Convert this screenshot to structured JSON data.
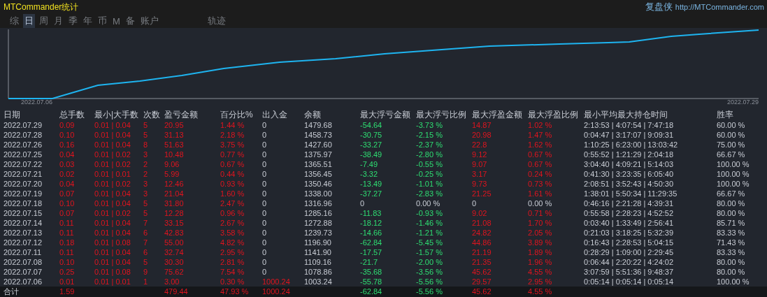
{
  "app_title": "MTCommander统计",
  "brand": {
    "name": "复盘侠",
    "url": "http://MTCommander.com"
  },
  "tabs": [
    {
      "label": "综",
      "selected": false
    },
    {
      "label": "日",
      "selected": true
    },
    {
      "label": "周",
      "selected": false
    },
    {
      "label": "月",
      "selected": false
    },
    {
      "label": "季",
      "selected": false
    },
    {
      "label": "年",
      "selected": false
    },
    {
      "label": "币",
      "selected": false
    },
    {
      "label": "M",
      "selected": false
    },
    {
      "label": "备",
      "selected": false
    },
    {
      "label": "账户",
      "selected": false
    },
    {
      "label": "轨迹",
      "selected": false
    }
  ],
  "chart": {
    "start_label": "2022.07.06",
    "end_label": "2022.07.29"
  },
  "table": {
    "columns": [
      "日期",
      "总手数",
      "最小|大手数",
      "次数",
      "盈亏金额",
      "百分比%",
      "出入金",
      "余额",
      "最大浮亏金额",
      "最大浮亏比例",
      "最大浮盈金额",
      "最大浮盈比例",
      "最小平均最大持仓时间",
      "胜率"
    ],
    "rows": [
      {
        "date": "2022.07.29",
        "lots": "0.09",
        "minmax": "0.01 | 0.04",
        "count": "5",
        "pnl": "20.95",
        "pct": "1.44 %",
        "flow": "0",
        "balance": "1479.68",
        "max_loss": "-54.64",
        "max_loss_pct": "-3.73 %",
        "max_gain": "14.87",
        "max_gain_pct": "1.02 %",
        "hold": "2:13:53 | 4:07:54 | 7:47:18",
        "win": "60.00 %",
        "deposit": false,
        "float_flat": false
      },
      {
        "date": "2022.07.28",
        "lots": "0.10",
        "minmax": "0.01 | 0.04",
        "count": "5",
        "pnl": "31.13",
        "pct": "2.18 %",
        "flow": "0",
        "balance": "1458.73",
        "max_loss": "-30.75",
        "max_loss_pct": "-2.15 %",
        "max_gain": "20.98",
        "max_gain_pct": "1.47 %",
        "hold": "0:04:47 | 3:17:07 | 9:09:31",
        "win": "60.00 %",
        "deposit": false,
        "float_flat": false
      },
      {
        "date": "2022.07.26",
        "lots": "0.16",
        "minmax": "0.01 | 0.04",
        "count": "8",
        "pnl": "51.63",
        "pct": "3.75 %",
        "flow": "0",
        "balance": "1427.60",
        "max_loss": "-33.27",
        "max_loss_pct": "-2.37 %",
        "max_gain": "22.8",
        "max_gain_pct": "1.62 %",
        "hold": "1:10:25 | 6:23:00 | 13:03:42",
        "win": "75.00 %",
        "deposit": false,
        "float_flat": false
      },
      {
        "date": "2022.07.25",
        "lots": "0.04",
        "minmax": "0.01 | 0.02",
        "count": "3",
        "pnl": "10.48",
        "pct": "0.77 %",
        "flow": "0",
        "balance": "1375.97",
        "max_loss": "-38.49",
        "max_loss_pct": "-2.80 %",
        "max_gain": "9.12",
        "max_gain_pct": "0.67 %",
        "hold": "0:55:52 | 1:21:29 | 2:04:18",
        "win": "66.67 %",
        "deposit": false,
        "float_flat": false
      },
      {
        "date": "2022.07.22",
        "lots": "0.03",
        "minmax": "0.01 | 0.02",
        "count": "2",
        "pnl": "9.06",
        "pct": "0.67 %",
        "flow": "0",
        "balance": "1365.51",
        "max_loss": "-7.49",
        "max_loss_pct": "-0.55 %",
        "max_gain": "9.07",
        "max_gain_pct": "0.67 %",
        "hold": "3:04:40 | 4:09:21 | 5:14:03",
        "win": "100.00 %",
        "deposit": false,
        "float_flat": false
      },
      {
        "date": "2022.07.21",
        "lots": "0.02",
        "minmax": "0.01 | 0.01",
        "count": "2",
        "pnl": "5.99",
        "pct": "0.44 %",
        "flow": "0",
        "balance": "1356.45",
        "max_loss": "-3.32",
        "max_loss_pct": "-0.25 %",
        "max_gain": "3.17",
        "max_gain_pct": "0.24 %",
        "hold": "0:41:30 | 3:23:35 | 6:05:40",
        "win": "100.00 %",
        "deposit": false,
        "float_flat": false
      },
      {
        "date": "2022.07.20",
        "lots": "0.04",
        "minmax": "0.01 | 0.02",
        "count": "3",
        "pnl": "12.46",
        "pct": "0.93 %",
        "flow": "0",
        "balance": "1350.46",
        "max_loss": "-13.49",
        "max_loss_pct": "-1.01 %",
        "max_gain": "9.73",
        "max_gain_pct": "0.73 %",
        "hold": "2:08:51 | 3:52:43 | 4:50:30",
        "win": "100.00 %",
        "deposit": false,
        "float_flat": false
      },
      {
        "date": "2022.07.19",
        "lots": "0.07",
        "minmax": "0.01 | 0.04",
        "count": "3",
        "pnl": "21.04",
        "pct": "1.60 %",
        "flow": "0",
        "balance": "1338.00",
        "max_loss": "-37.27",
        "max_loss_pct": "-2.83 %",
        "max_gain": "21.25",
        "max_gain_pct": "1.61 %",
        "hold": "1:38:01 | 5:50:34 | 11:29:35",
        "win": "66.67 %",
        "deposit": false,
        "float_flat": false
      },
      {
        "date": "2022.07.18",
        "lots": "0.10",
        "minmax": "0.01 | 0.04",
        "count": "5",
        "pnl": "31.80",
        "pct": "2.47 %",
        "flow": "0",
        "balance": "1316.96",
        "max_loss": "0",
        "max_loss_pct": "0.00 %",
        "max_gain": "0",
        "max_gain_pct": "0.00 %",
        "hold": "0:46:16 | 2:21:28 | 4:39:31",
        "win": "80.00 %",
        "deposit": false,
        "float_flat": true
      },
      {
        "date": "2022.07.15",
        "lots": "0.07",
        "minmax": "0.01 | 0.02",
        "count": "5",
        "pnl": "12.28",
        "pct": "0.96 %",
        "flow": "0",
        "balance": "1285.16",
        "max_loss": "-11.83",
        "max_loss_pct": "-0.93 %",
        "max_gain": "9.02",
        "max_gain_pct": "0.71 %",
        "hold": "0:55:58 | 2:28:23 | 4:52:52",
        "win": "80.00 %",
        "deposit": false,
        "float_flat": false
      },
      {
        "date": "2022.07.14",
        "lots": "0.11",
        "minmax": "0.01 | 0.04",
        "count": "7",
        "pnl": "33.15",
        "pct": "2.67 %",
        "flow": "0",
        "balance": "1272.88",
        "max_loss": "-18.12",
        "max_loss_pct": "-1.46 %",
        "max_gain": "21.08",
        "max_gain_pct": "1.70 %",
        "hold": "0:03:40 | 1:33:49 | 2:56:41",
        "win": "85.71 %",
        "deposit": false,
        "float_flat": false
      },
      {
        "date": "2022.07.13",
        "lots": "0.11",
        "minmax": "0.01 | 0.04",
        "count": "6",
        "pnl": "42.83",
        "pct": "3.58 %",
        "flow": "0",
        "balance": "1239.73",
        "max_loss": "-14.66",
        "max_loss_pct": "-1.21 %",
        "max_gain": "24.82",
        "max_gain_pct": "2.05 %",
        "hold": "0:21:03 | 3:18:25 | 5:32:39",
        "win": "83.33 %",
        "deposit": false,
        "float_flat": false
      },
      {
        "date": "2022.07.12",
        "lots": "0.18",
        "minmax": "0.01 | 0.08",
        "count": "7",
        "pnl": "55.00",
        "pct": "4.82 %",
        "flow": "0",
        "balance": "1196.90",
        "max_loss": "-62.84",
        "max_loss_pct": "-5.45 %",
        "max_gain": "44.86",
        "max_gain_pct": "3.89 %",
        "hold": "0:16:43 | 2:28:53 | 5:04:15",
        "win": "71.43 %",
        "deposit": false,
        "float_flat": false
      },
      {
        "date": "2022.07.11",
        "lots": "0.11",
        "minmax": "0.01 | 0.04",
        "count": "6",
        "pnl": "32.74",
        "pct": "2.95 %",
        "flow": "0",
        "balance": "1141.90",
        "max_loss": "-17.57",
        "max_loss_pct": "-1.57 %",
        "max_gain": "21.19",
        "max_gain_pct": "1.89 %",
        "hold": "0:28:29 | 1:09:00 | 2:29:45",
        "win": "83.33 %",
        "deposit": false,
        "float_flat": false
      },
      {
        "date": "2022.07.08",
        "lots": "0.10",
        "minmax": "0.01 | 0.04",
        "count": "5",
        "pnl": "30.30",
        "pct": "2.81 %",
        "flow": "0",
        "balance": "1109.16",
        "max_loss": "-21.7",
        "max_loss_pct": "-2.00 %",
        "max_gain": "21.35",
        "max_gain_pct": "1.96 %",
        "hold": "0:06:44 | 2:20:22 | 4:24:02",
        "win": "80.00 %",
        "deposit": false,
        "float_flat": false
      },
      {
        "date": "2022.07.07",
        "lots": "0.25",
        "minmax": "0.01 | 0.08",
        "count": "9",
        "pnl": "75.62",
        "pct": "7.54 %",
        "flow": "0",
        "balance": "1078.86",
        "max_loss": "-35.68",
        "max_loss_pct": "-3.56 %",
        "max_gain": "45.62",
        "max_gain_pct": "4.55 %",
        "hold": "3:07:59 | 5:51:36 | 9:48:37",
        "win": "80.00 %",
        "deposit": false,
        "float_flat": false
      },
      {
        "date": "2022.07.06",
        "lots": "0.01",
        "minmax": "0.01 | 0.01",
        "count": "1",
        "pnl": "3.00",
        "pct": "0.30 %",
        "flow": "1000.24",
        "balance": "1003.24",
        "max_loss": "-55.78",
        "max_loss_pct": "-5.56 %",
        "max_gain": "29.57",
        "max_gain_pct": "2.95 %",
        "hold": "0:05:14 | 0:05:14 | 0:05:14",
        "win": "100.00 %",
        "deposit": true,
        "float_flat": false
      }
    ],
    "total": {
      "date": "合计",
      "lots": "1.59",
      "pnl": "479.44",
      "pct": "47.93 %",
      "flow": "1000.24",
      "max_loss": "-62.84",
      "max_loss_pct": "-5.56 %",
      "max_gain": "45.62",
      "max_gain_pct": "4.55 %",
      "deposit": true,
      "float_flat": false
    }
  }
}
